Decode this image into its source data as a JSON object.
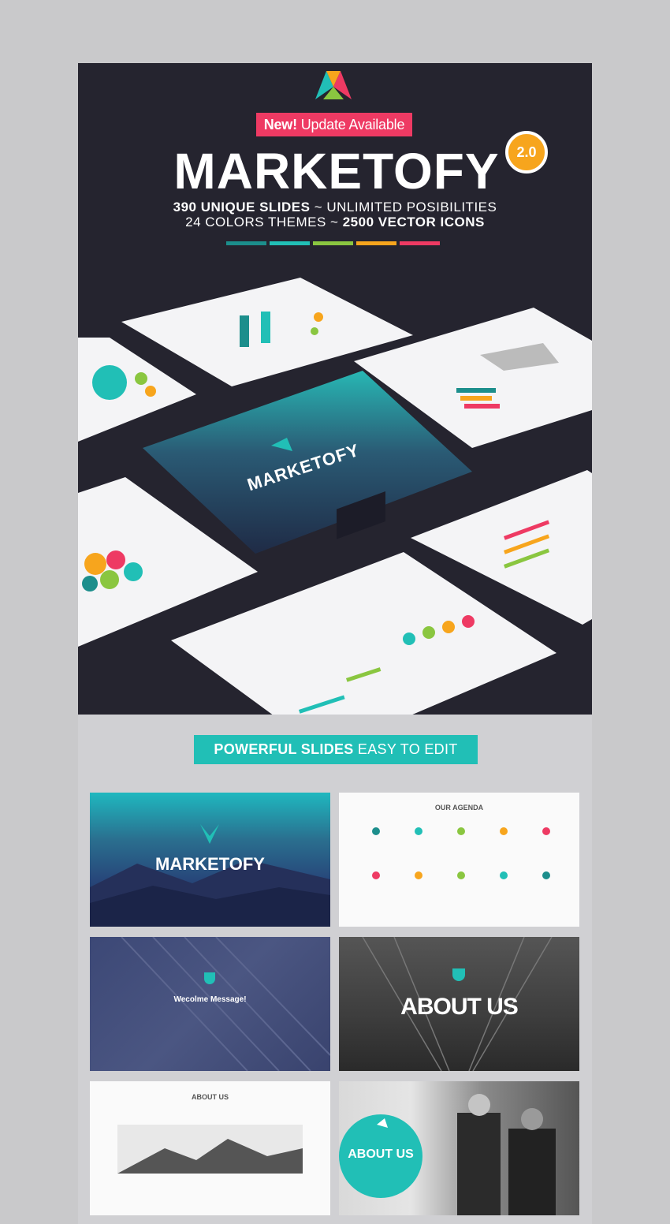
{
  "hero": {
    "badge_new": "New!",
    "badge_rest": "Update Available",
    "title": "MARKETOFY",
    "version": "2.0",
    "line1_bold": "390 UNIQUE SLIDES",
    "line1_rest": "~ UNLIMITED POSIBILITIES",
    "line2_rest": "24 COLORS THEMES ~",
    "line2_bold": "2500 VECTOR ICONS",
    "bar_colors": [
      "#1c8e8c",
      "#21bfb6",
      "#8ac640",
      "#f7a51d",
      "#ee3a63"
    ]
  },
  "mockup": {
    "main_title": "MARKETOFY"
  },
  "edit_banner": {
    "bold": "POWERFUL SLIDES",
    "rest": "EASY TO EDIT"
  },
  "thumbnails": {
    "t1_title": "MARKETOFY",
    "t2_title": "OUR AGENDA",
    "t3_title": "Wecolme Message!",
    "t4_title": "ABOUT US",
    "t5_title": "ABOUT US",
    "t6_title": "ABOUT US"
  },
  "agenda_items": [
    {
      "color": "#1c8e8c"
    },
    {
      "color": "#21bfb6"
    },
    {
      "color": "#8ac640"
    },
    {
      "color": "#f7a51d"
    },
    {
      "color": "#ee3a63"
    },
    {
      "color": "#ee3a63"
    },
    {
      "color": "#f7a51d"
    },
    {
      "color": "#8ac640"
    },
    {
      "color": "#21bfb6"
    },
    {
      "color": "#1c8e8c"
    }
  ]
}
